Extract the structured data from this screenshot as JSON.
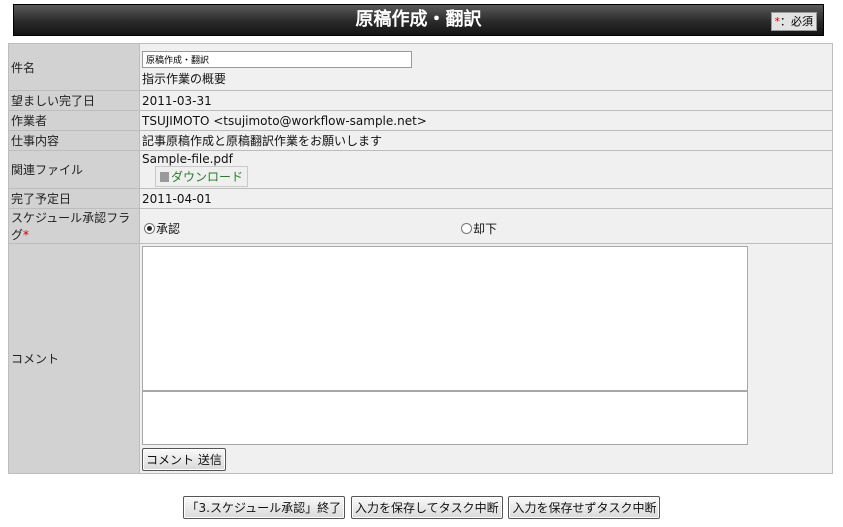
{
  "header": {
    "title": "原稿作成・翻訳",
    "required_star": "*",
    "required_note": "：必須"
  },
  "rows": {
    "subject": {
      "label": "件名",
      "value": "原稿作成・翻訳",
      "summary": "指示作業の概要"
    },
    "desired_date": {
      "label": "望ましい完了日",
      "value": "2011-03-31"
    },
    "worker": {
      "label": "作業者",
      "value": "TSUJIMOTO <tsujimoto@workflow-sample.net>"
    },
    "task": {
      "label": "仕事内容",
      "value": "記事原稿作成と原稿翻訳作業をお願いします"
    },
    "files": {
      "label": "関連ファイル",
      "filename": "Sample-file.pdf",
      "download": "ダウンロード"
    },
    "planned_date": {
      "label": "完了予定日",
      "value": "2011-04-01"
    },
    "approval": {
      "label": "スケジュール承認フラグ",
      "required_star": "*",
      "approve": "承認",
      "reject": "却下",
      "selected": "承認"
    },
    "comment": {
      "label": "コメント",
      "send": "コメント 送信"
    }
  },
  "footer": {
    "finish": "「3.スケジュール承認」終了",
    "save_pause": "入力を保存してタスク中断",
    "nosave_pause": "入力を保存せずタスク中断"
  }
}
